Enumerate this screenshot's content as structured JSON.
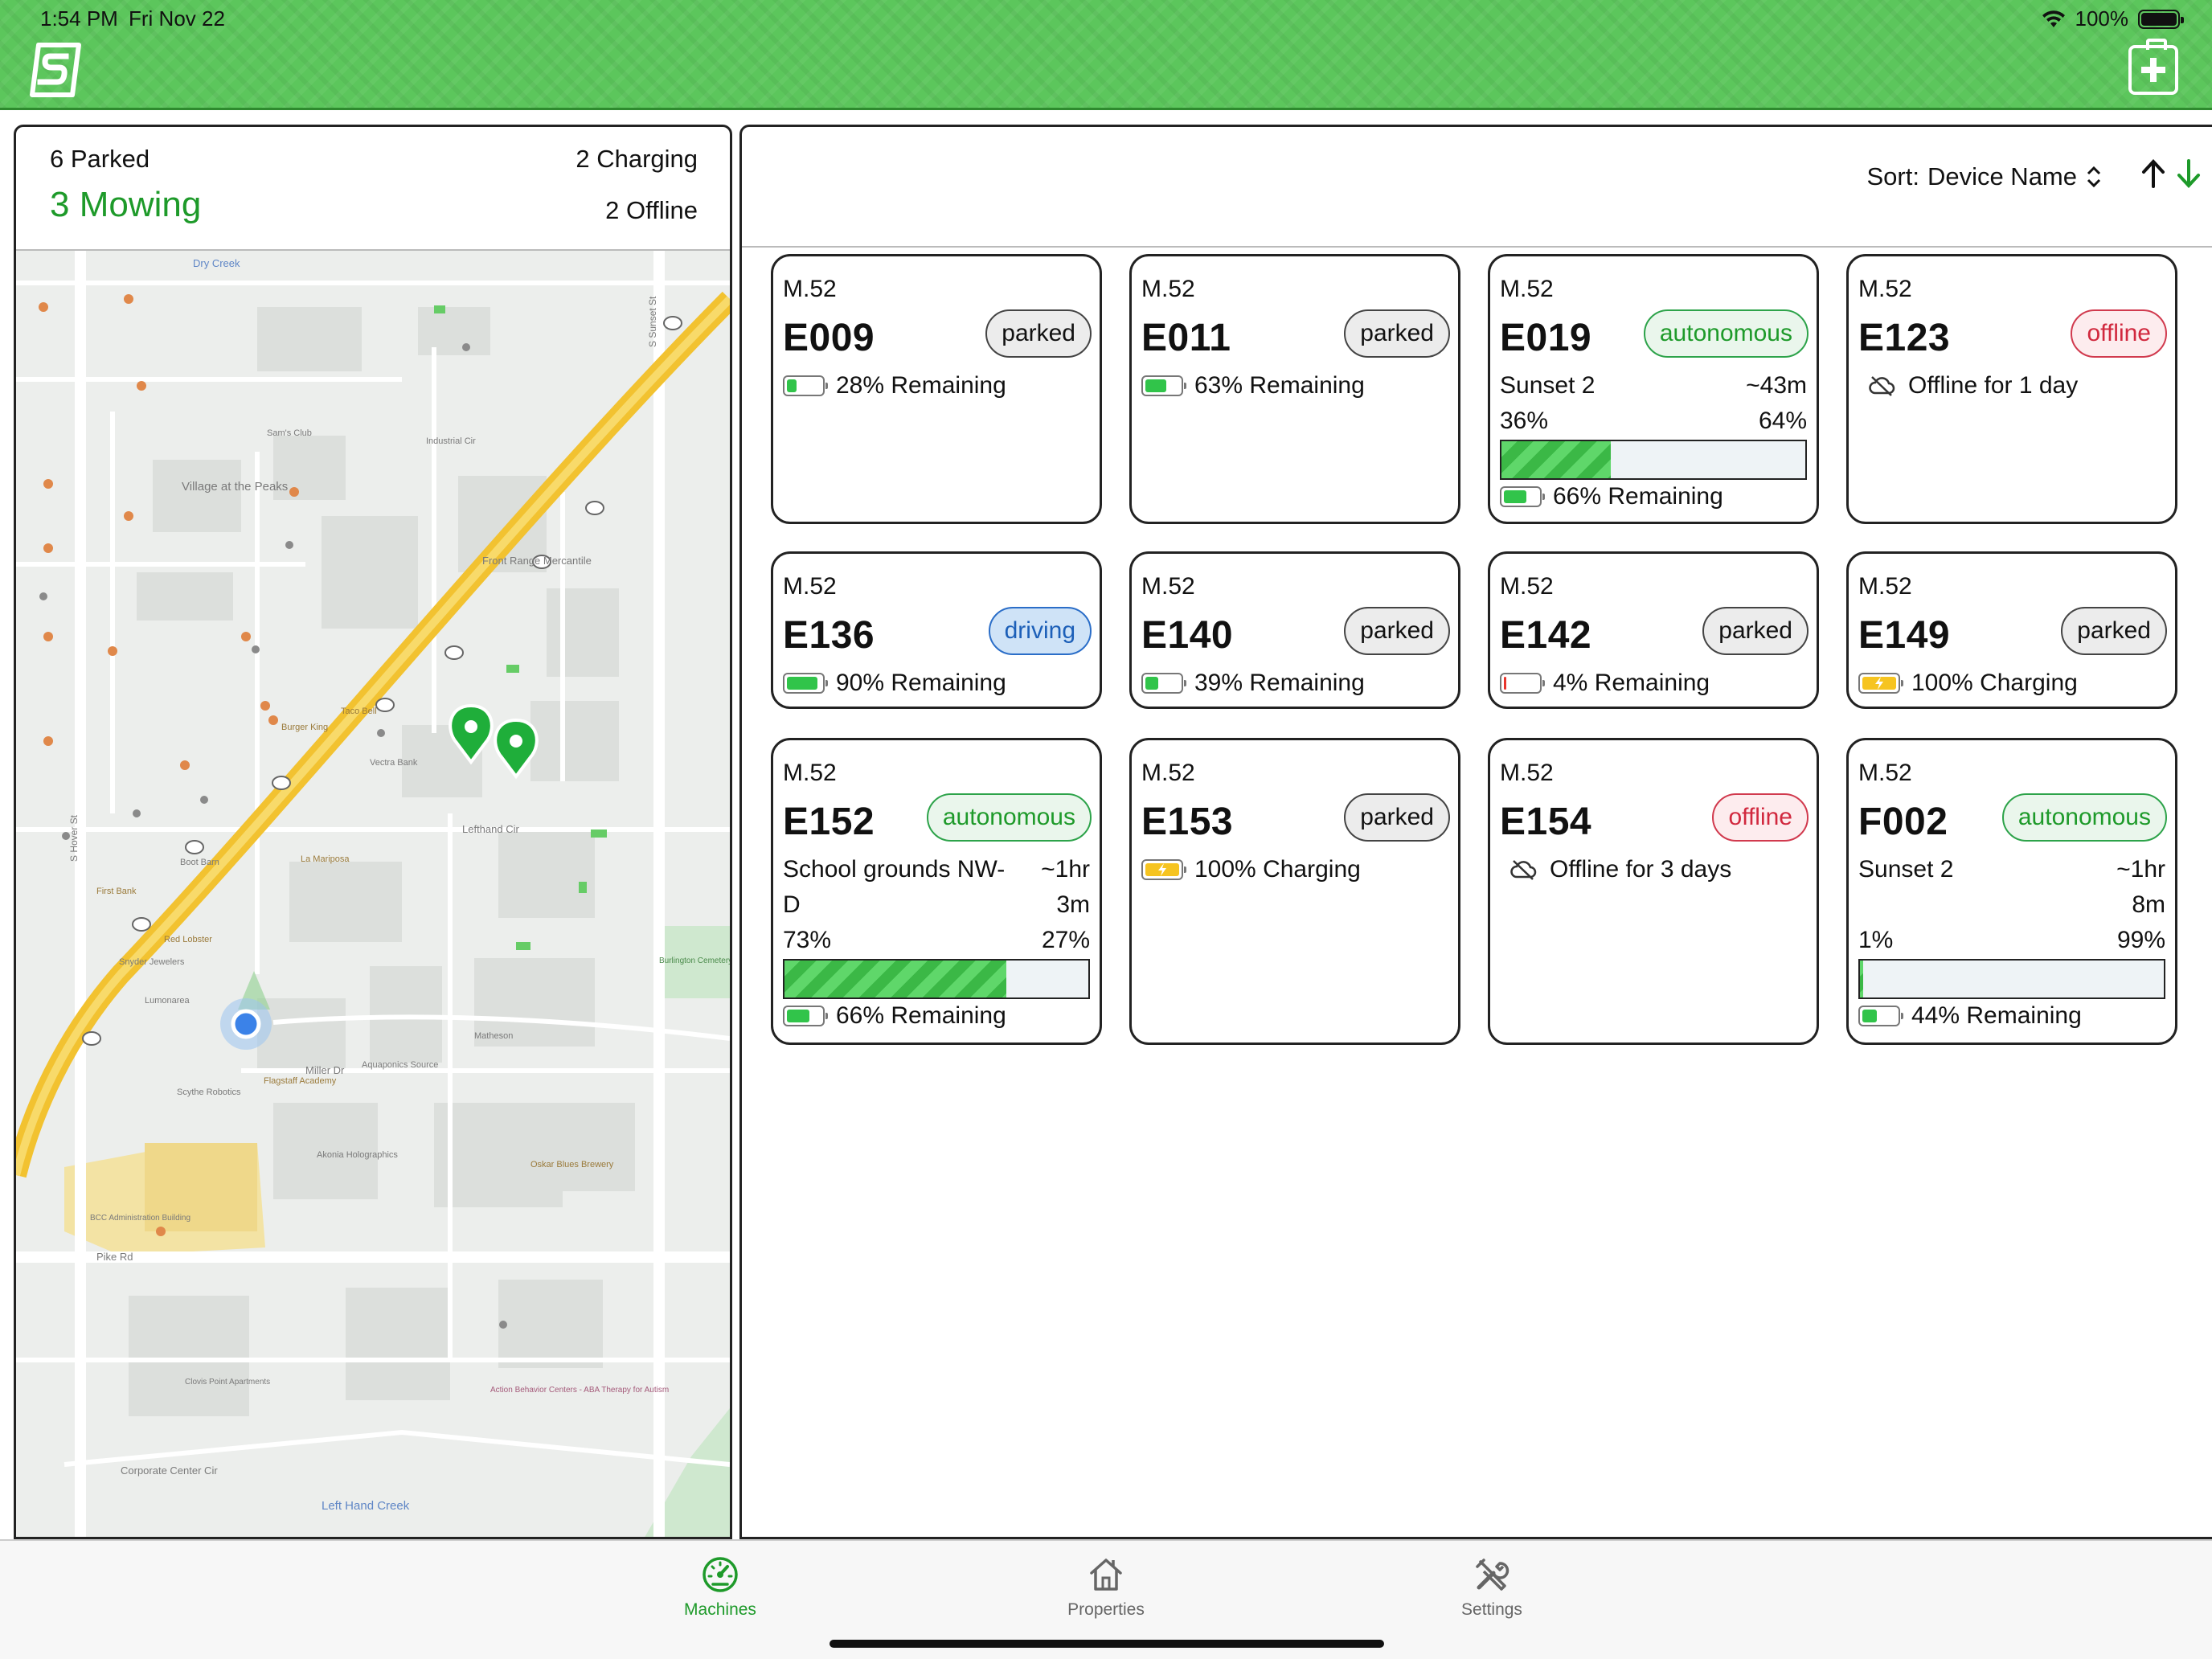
{
  "status_bar": {
    "time": "1:54 PM",
    "date": "Fri Nov 22",
    "battery": "100%"
  },
  "summary": {
    "parked": "6 Parked",
    "mowing": "3 Mowing",
    "charging": "2 Charging",
    "offline": "2 Offline"
  },
  "sort": {
    "label": "Sort:",
    "value": "Device Name"
  },
  "colors": {
    "brand_green": "#5cc65c",
    "accent_green": "#1e9a2a",
    "offline_red": "#d1283e",
    "driving_blue": "#1c5fb8"
  },
  "map_labels": {
    "villageAtThePeaks": "Village at the Peaks",
    "industrialCir": "Industrial Cir",
    "frontRange": "Front Range Mercantile",
    "lefthandCir": "Lefthand Cir",
    "millerDr": "Miller Dr",
    "pikeRd": "Pike Rd",
    "corporateCenter": "Corporate Center Cir",
    "leftHandCreek": "Left Hand Creek",
    "sSunsetSt": "S Sunset St",
    "sHoverSt": "S Hover St",
    "dryCreek": "Dry Creek",
    "flagstaff": "Flagstaff Academy",
    "burgerKing": "Burger King",
    "burlington": "Burlington Cemetery",
    "bccAdmin": "BCC Administration Building",
    "tacoBell": "Taco Bell",
    "samsClub": "Sam's Club",
    "vectraBank": "Vectra Bank",
    "firstBank": "First Bank",
    "bootBarn": "Boot Barn",
    "laMariposa": "La Mariposa",
    "redLobster": "Red Lobster",
    "snyder": "Snyder Jewelers",
    "lumonarea": "Lumonarea",
    "aquaponics": "Aquaponics Source",
    "scythe": "Scythe Robotics",
    "akonia": "Akonia Holographics",
    "oskarBlues": "Oskar Blues Brewery",
    "matheson": "Matheson",
    "clovisPoint": "Clovis Point Apartments",
    "actionBehavior": "Action Behavior Centers - ABA Therapy for Autism"
  },
  "machines": [
    {
      "model": "M.52",
      "name": "E009",
      "status": "parked",
      "battery_pct": 28,
      "battery_text": "28% Remaining"
    },
    {
      "model": "M.52",
      "name": "E011",
      "status": "parked",
      "battery_pct": 63,
      "battery_text": "63% Remaining"
    },
    {
      "model": "M.52",
      "name": "E019",
      "status": "autonomous",
      "job_name": "Sunset 2",
      "job_time": "~43m",
      "done_pct_text": "36%",
      "remaining_pct_text": "64%",
      "progress": 36,
      "battery_pct": 66,
      "battery_text": "66% Remaining"
    },
    {
      "model": "M.52",
      "name": "E123",
      "status": "offline",
      "offline_text": "Offline for 1 day"
    },
    {
      "model": "M.52",
      "name": "E136",
      "status": "driving",
      "battery_pct": 90,
      "battery_text": "90% Remaining"
    },
    {
      "model": "M.52",
      "name": "E140",
      "status": "parked",
      "battery_pct": 39,
      "battery_text": "39% Remaining"
    },
    {
      "model": "M.52",
      "name": "E142",
      "status": "parked",
      "battery_pct": 4,
      "battery_text": "4% Remaining"
    },
    {
      "model": "M.52",
      "name": "E149",
      "status": "parked",
      "battery_pct": 100,
      "charging": true,
      "battery_text": "100% Charging"
    },
    {
      "model": "M.52",
      "name": "E152",
      "status": "autonomous",
      "job_name_line1": "School grounds NW-",
      "job_name_line2": "D",
      "job_time_line1": "~1hr",
      "job_time_line2": "3m",
      "done_pct_text": "73%",
      "remaining_pct_text": "27%",
      "progress": 73,
      "battery_pct": 66,
      "battery_text": "66% Remaining"
    },
    {
      "model": "M.52",
      "name": "E153",
      "status": "parked",
      "battery_pct": 100,
      "charging": true,
      "battery_text": "100% Charging"
    },
    {
      "model": "M.52",
      "name": "E154",
      "status": "offline",
      "offline_text": "Offline for 3 days"
    },
    {
      "model": "M.52",
      "name": "F002",
      "status": "autonomous",
      "job_name_line1": "Sunset 2",
      "job_name_line2": "",
      "job_time_line1": "~1hr",
      "job_time_line2": "8m",
      "done_pct_text": "1%",
      "remaining_pct_text": "99%",
      "progress": 1,
      "battery_pct": 44,
      "battery_text": "44% Remaining"
    }
  ],
  "tabs": [
    {
      "label": "Machines",
      "icon": "speedometer-icon",
      "active": true
    },
    {
      "label": "Properties",
      "icon": "house-icon",
      "active": false
    },
    {
      "label": "Settings",
      "icon": "wrench-screwdriver-icon",
      "active": false
    }
  ]
}
